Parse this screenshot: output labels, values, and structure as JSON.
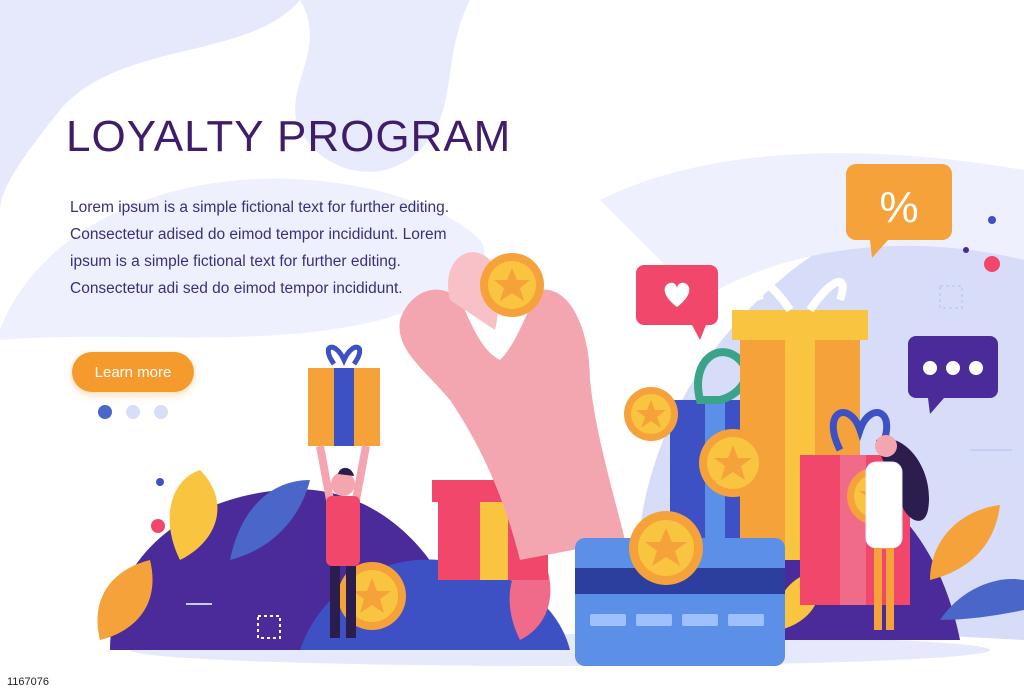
{
  "hero": {
    "title": "LOYALTY PROGRAM",
    "body": "Lorem ipsum is a simple fictional text for further editing. Consectetur adised do eimod tempor incididunt. Lorem ipsum is a simple fictional text for further editing. Consectetur adi sed do eimod tempor incididunt.",
    "cta_label": "Learn more",
    "pager": {
      "count": 3,
      "active": 1
    }
  },
  "illustration": {
    "percent_badge": "%",
    "icons": [
      "heart-icon",
      "chat-dots-icon",
      "percent-icon",
      "star-coin-icon",
      "gift-box-icon",
      "credit-card-icon"
    ]
  },
  "footer": {
    "image_id": "1167076"
  },
  "colors": {
    "title": "#3f1d6b",
    "text": "#3a2f7c",
    "cta": "#f59a2c",
    "pager_active": "#4a66c8",
    "pager_inactive": "#d9def7",
    "blob_light": "#e6e9fb",
    "blob_mid": "#c7cef6",
    "purple": "#4b2a9a",
    "card": "#5b8fe8"
  }
}
